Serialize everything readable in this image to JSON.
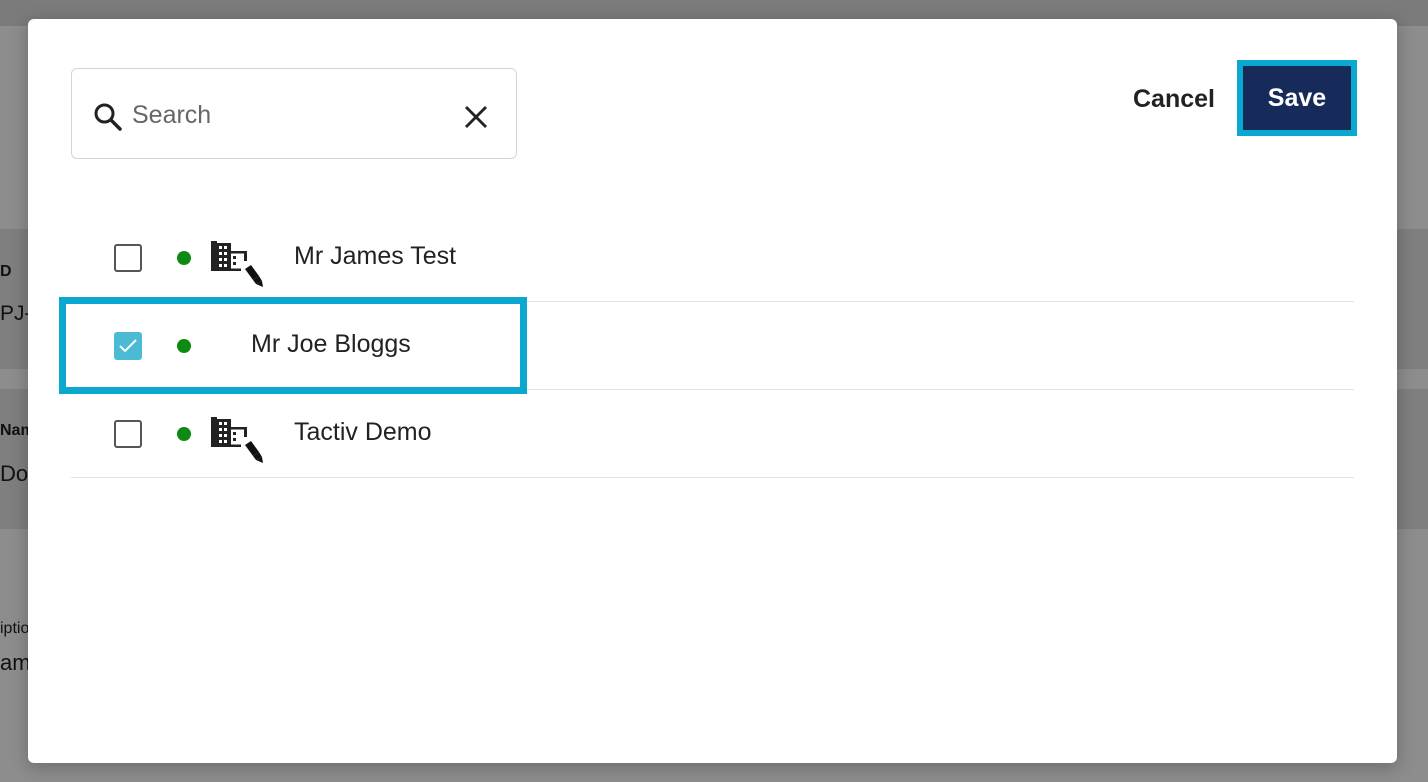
{
  "background": {
    "labels": [
      "D",
      "PJ-",
      "Nam",
      "Doi",
      "iptio",
      "am"
    ]
  },
  "dialog": {
    "search": {
      "placeholder": "Search",
      "value": ""
    },
    "cancel_label": "Cancel",
    "save_label": "Save",
    "items": [
      {
        "label": "Mr James Test",
        "checked": false,
        "status": "online",
        "icon": "company-edit-icon"
      },
      {
        "label": "Mr Joe Bloggs",
        "checked": true,
        "status": "online",
        "icon": null
      },
      {
        "label": "Tactiv Demo",
        "checked": false,
        "status": "online",
        "icon": "company-edit-icon"
      }
    ]
  },
  "colors": {
    "accent": "#0aa7cf",
    "save_bg": "#172b5a",
    "checkbox_checked": "#4bbad3",
    "status_online": "#0d8a12"
  }
}
